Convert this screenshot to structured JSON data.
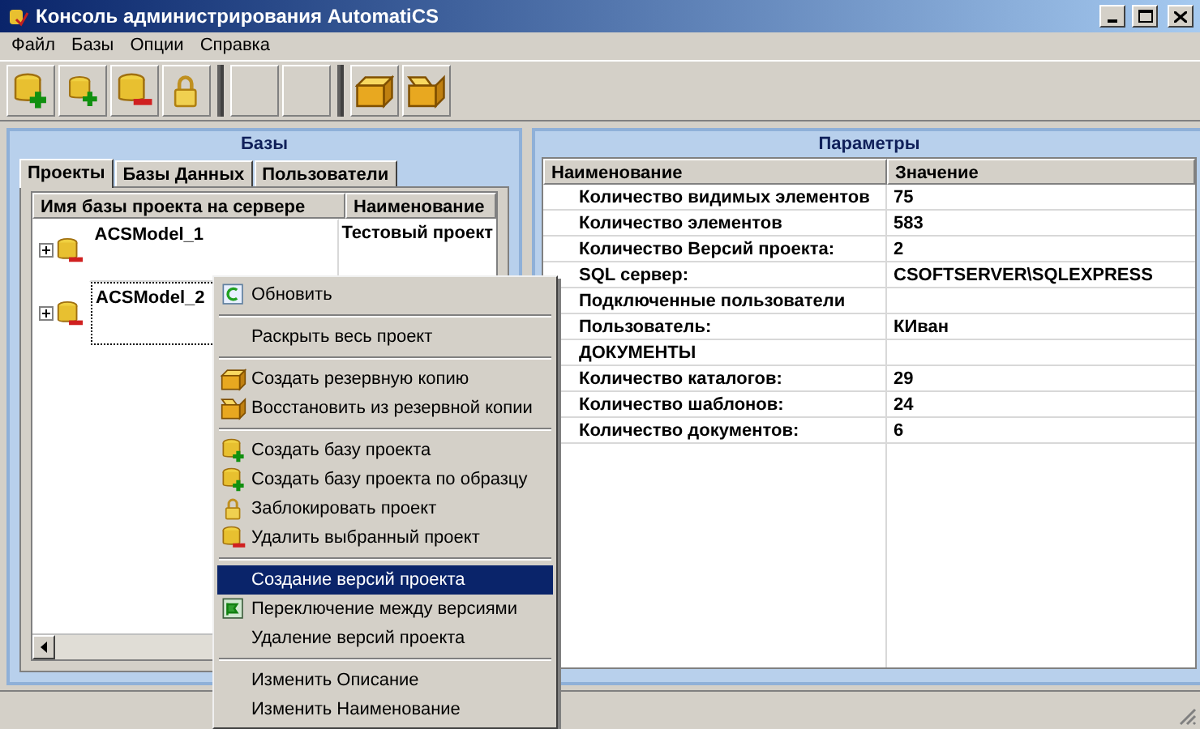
{
  "window": {
    "title": "Консоль администрирования AutomatiCS"
  },
  "menu": [
    "Файл",
    "Базы",
    "Опции",
    "Справка"
  ],
  "toolbar": [
    {
      "kind": "db-add"
    },
    {
      "kind": "db-copy"
    },
    {
      "kind": "db-remove"
    },
    {
      "kind": "lock"
    },
    {
      "kind": "blank"
    },
    {
      "kind": "blank"
    },
    {
      "kind": "box"
    },
    {
      "kind": "box-open"
    }
  ],
  "bases": {
    "title": "Базы",
    "tabs": [
      {
        "label": "Проекты",
        "selected": true
      },
      {
        "label": "Базы Данных",
        "selected": false
      },
      {
        "label": "Пользователи",
        "selected": false
      }
    ],
    "columns": [
      "Имя базы проекта на сервере",
      "Наименование"
    ],
    "rows": [
      {
        "name": "ACSModel_1",
        "description": "Тестовый проект",
        "selected": false
      },
      {
        "name": "ACSModel_2",
        "selected": true
      }
    ]
  },
  "parameters": {
    "title": "Параметры",
    "columns": [
      "Наименование",
      "Значение"
    ],
    "rows": [
      {
        "name": "Количество видимых элементов",
        "value": "75"
      },
      {
        "name": "Количество элементов",
        "value": "583"
      },
      {
        "name": "Количество Версий проекта:",
        "value": "2"
      },
      {
        "name": "SQL сервер:",
        "value": "CSOFTSERVER\\SQLEXPRESS"
      },
      {
        "name": "Подключенные пользователи"
      },
      {
        "name": "Пользователь:",
        "value": "КИван"
      },
      {
        "name": "ДОКУМЕНТЫ"
      },
      {
        "name": "Количество каталогов:",
        "value": "29"
      },
      {
        "name": "Количество шаблонов:",
        "value": "24"
      },
      {
        "name": "Количество документов:",
        "value": "6"
      }
    ]
  },
  "context_menu": [
    {
      "kind": "item",
      "label": "Обновить",
      "selected": false
    },
    {
      "kind": "separator"
    },
    {
      "kind": "item",
      "label": "Раскрыть весь проект",
      "selected": false
    },
    {
      "kind": "separator"
    },
    {
      "kind": "item",
      "label": "Создать резервную копию",
      "selected": false
    },
    {
      "kind": "item",
      "label": "Восстановить из резервной копии",
      "selected": false
    },
    {
      "kind": "separator"
    },
    {
      "kind": "item",
      "label": "Создать базу проекта",
      "selected": false
    },
    {
      "kind": "item",
      "label": "Создать базу проекта по образцу",
      "selected": false
    },
    {
      "kind": "item",
      "label": "Заблокировать проект",
      "selected": false
    },
    {
      "kind": "item",
      "label": "Удалить выбранный проект",
      "selected": false
    },
    {
      "kind": "separator"
    },
    {
      "kind": "item",
      "label": "Создание версий проекта",
      "selected": true
    },
    {
      "kind": "item",
      "label": "Переключение между версиями",
      "selected": false
    },
    {
      "kind": "item",
      "label": "Удаление версий проекта",
      "selected": false
    },
    {
      "kind": "separator"
    },
    {
      "kind": "item",
      "label": "Изменить Описание",
      "selected": false
    },
    {
      "kind": "item",
      "label": "Изменить Наименование",
      "selected": false
    }
  ]
}
